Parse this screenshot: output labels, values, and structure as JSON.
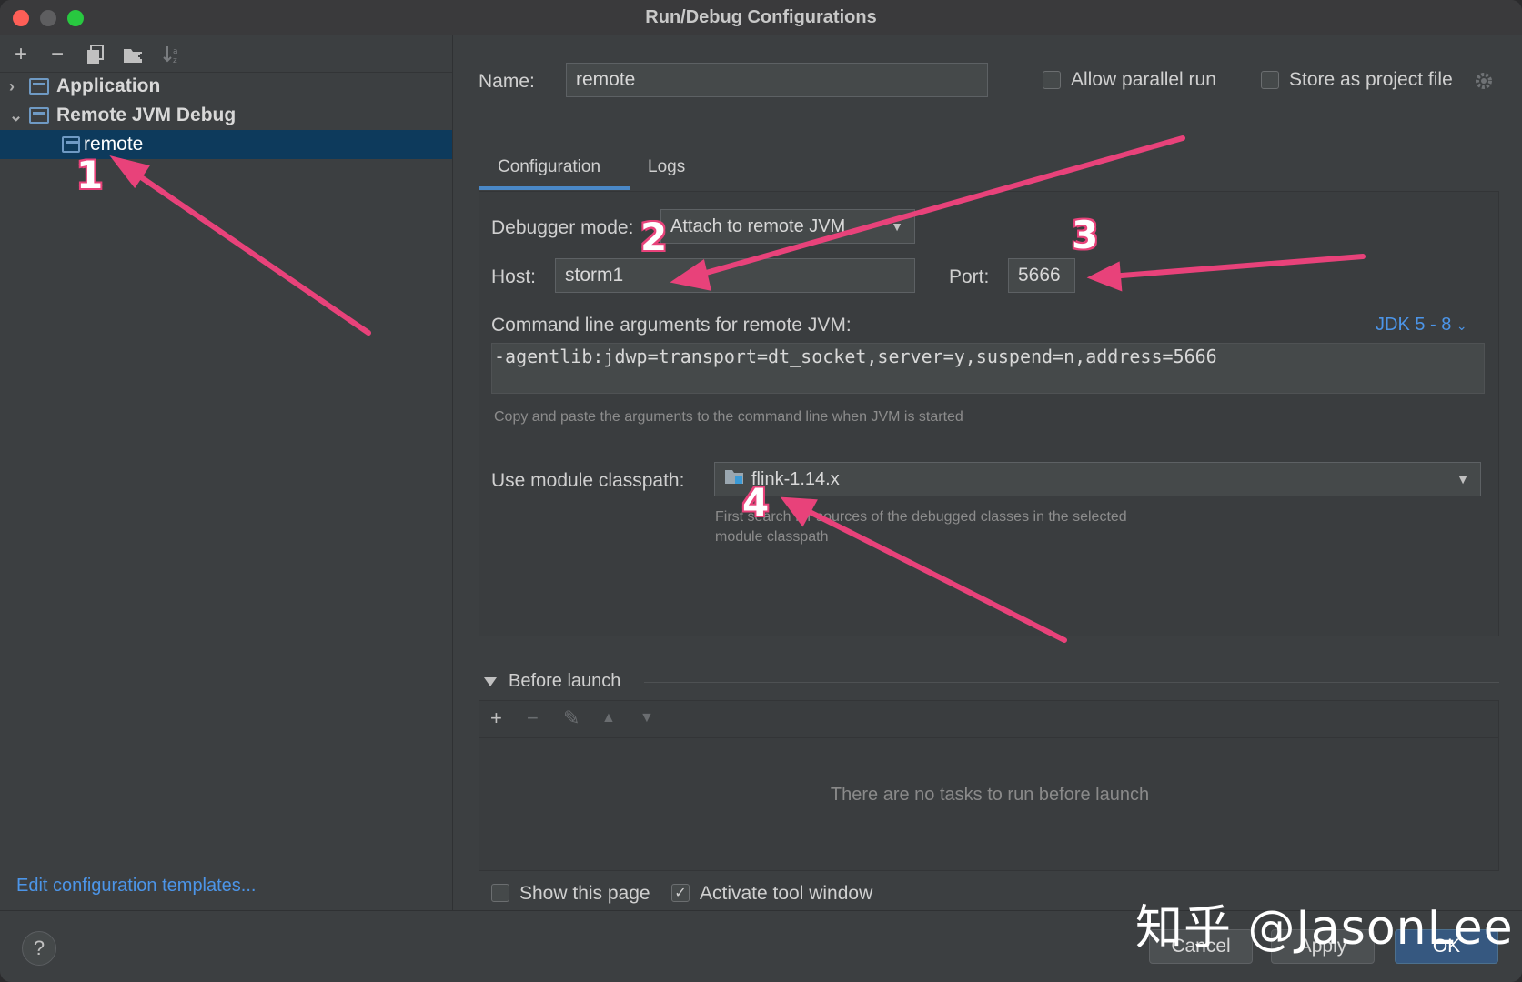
{
  "window": {
    "title": "Run/Debug Configurations"
  },
  "left": {
    "toolbar_icons": [
      "add-icon",
      "remove-icon",
      "copy-icon",
      "folder-add-icon",
      "sort-icon"
    ],
    "tree": [
      {
        "label": "Application",
        "expanded": false
      },
      {
        "label": "Remote JVM Debug",
        "expanded": true
      },
      {
        "label": "remote",
        "selected": true
      }
    ],
    "edit_templates": "Edit configuration templates..."
  },
  "header": {
    "name_label": "Name:",
    "name_value": "remote",
    "allow_parallel": "Allow parallel run",
    "store_project": "Store as project file"
  },
  "tabs": [
    "Configuration",
    "Logs"
  ],
  "config": {
    "debugger_mode_label": "Debugger mode:",
    "debugger_mode_value": "Attach to remote JVM",
    "host_label": "Host:",
    "host_value": "storm1",
    "port_label": "Port:",
    "port_value": "5666",
    "cmd_label": "Command line arguments for remote JVM:",
    "jdk_selector": "JDK 5 - 8",
    "cmd_value": "-agentlib:jdwp=transport=dt_socket,server=y,suspend=n,address=5666",
    "cmd_hint": "Copy and paste the arguments to the command line when JVM is started",
    "module_label": "Use module classpath:",
    "module_value": "flink-1.14.x",
    "module_hint_1": "First search for sources of the debugged classes in the selected",
    "module_hint_2": "module classpath"
  },
  "before_launch": {
    "title": "Before launch",
    "empty": "There are no tasks to run before launch"
  },
  "footer": {
    "show_page": "Show this page",
    "activate_tool": "Activate tool window",
    "show_page_checked": false,
    "activate_tool_checked": true,
    "cancel": "Cancel",
    "apply": "Apply",
    "ok": "OK",
    "help": "?"
  },
  "annotations": [
    "1",
    "2",
    "3",
    "4"
  ],
  "watermark": "知乎 @JasonLee",
  "colors": {
    "accent": "#4a88c7",
    "link": "#4c95e8",
    "arrow": "#e8427a",
    "selection": "#0d3a5c"
  }
}
